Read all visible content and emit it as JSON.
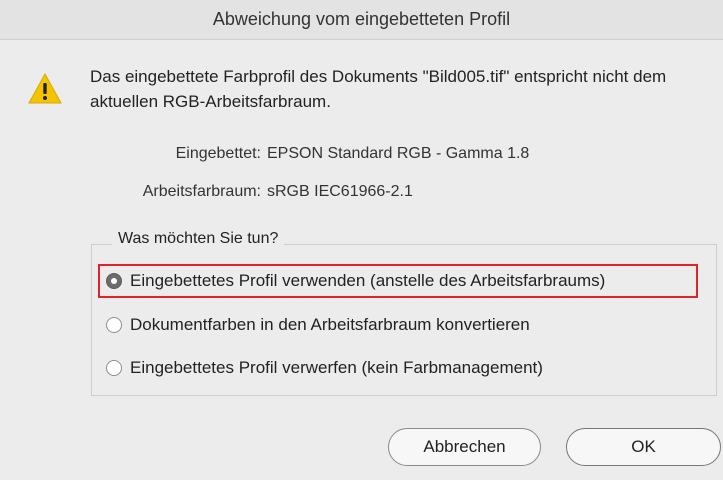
{
  "dialog": {
    "title": "Abweichung vom eingebetteten Profil",
    "message": "Das eingebettete Farbprofil des Dokuments \"Bild005.tif\" entspricht nicht dem aktuellen RGB-Arbeitsfarbraum.",
    "embedded_label": "Eingebettet:",
    "embedded_value": "EPSON  Standard RGB - Gamma 1.8",
    "working_label": "Arbeitsfarbraum:",
    "working_value": "sRGB IEC61966-2.1",
    "group_title": "Was möchten Sie tun?",
    "options": [
      {
        "label": "Eingebettetes Profil verwenden (anstelle des Arbeitsfarbraums)",
        "selected": true
      },
      {
        "label": "Dokumentfarben in den Arbeitsfarbraum konvertieren",
        "selected": false
      },
      {
        "label": "Eingebettetes Profil verwerfen (kein Farbmanagement)",
        "selected": false
      }
    ],
    "cancel_label": "Abbrechen",
    "ok_label": "OK"
  },
  "icons": {
    "warning": "warning-triangle-icon"
  },
  "colors": {
    "highlight": "#e0242b",
    "warning_fill": "#f5c400"
  }
}
